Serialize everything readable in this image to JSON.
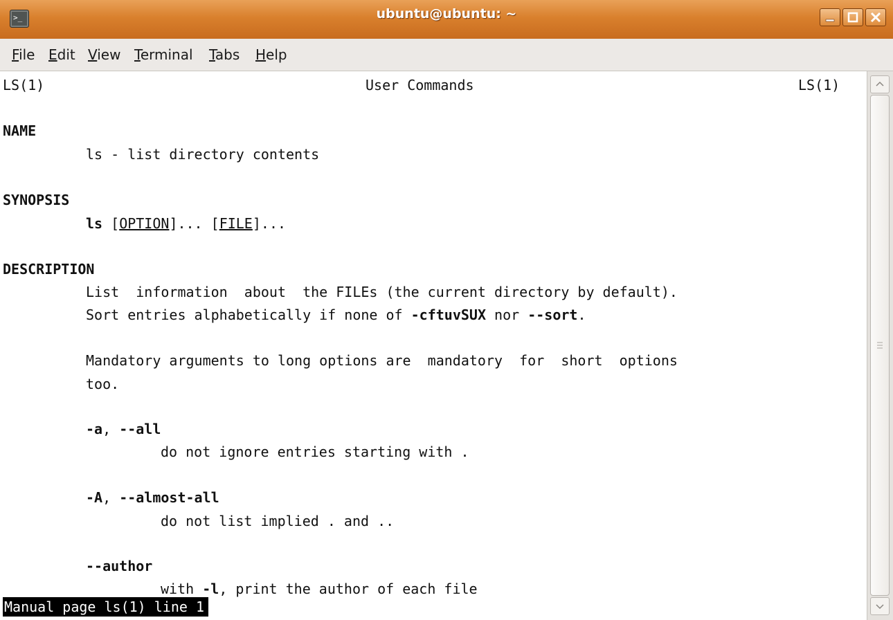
{
  "window": {
    "title": "ubuntu@ubuntu: ~"
  },
  "icons": {
    "app": "terminal-icon",
    "minimize": "minimize-icon",
    "maximize": "maximize-icon",
    "close": "close-icon"
  },
  "menu": {
    "items": [
      {
        "label": "File",
        "mnemonic": "F",
        "rest": "ile"
      },
      {
        "label": "Edit",
        "mnemonic": "E",
        "rest": "dit"
      },
      {
        "label": "View",
        "mnemonic": "V",
        "rest": "iew"
      },
      {
        "label": "Terminal",
        "mnemonic": "T",
        "rest": "erminal"
      },
      {
        "label": "Tabs",
        "mnemonic": "T",
        "rest": "abs"
      },
      {
        "label": "Help",
        "mnemonic": "H",
        "rest": "elp"
      }
    ]
  },
  "man": {
    "header_left": "LS(1)",
    "header_center": "User Commands",
    "header_right": "LS(1)",
    "name_heading": "NAME",
    "name_text": "ls - list directory contents",
    "synopsis_heading": "SYNOPSIS",
    "synopsis_cmd": "ls",
    "synopsis_option": "OPTION",
    "synopsis_file": "FILE",
    "description_heading": "DESCRIPTION",
    "desc_line1": "List  information  about  the FILEs (the current directory by default).",
    "desc_line2_pre": "Sort entries alphabetically if none of ",
    "desc_line2_flag1": "-cftuvSUX",
    "desc_line2_mid": " nor ",
    "desc_line2_flag2": "--sort",
    "desc_line2_post": ".",
    "desc_line3": "Mandatory arguments to long options are  mandatory  for  short  options",
    "desc_line4": "too.",
    "opt_a_short": "-a",
    "opt_a_long": "--all",
    "opt_a_desc": "do not ignore entries starting with .",
    "opt_A_short": "-A",
    "opt_A_long": "--almost-all",
    "opt_A_desc": "do not list implied . and ..",
    "opt_author": "--author",
    "opt_author_pre": "with ",
    "opt_author_flag": "-l",
    "opt_author_post": ", print the author of each file"
  },
  "status": "Manual page ls(1) line 1"
}
